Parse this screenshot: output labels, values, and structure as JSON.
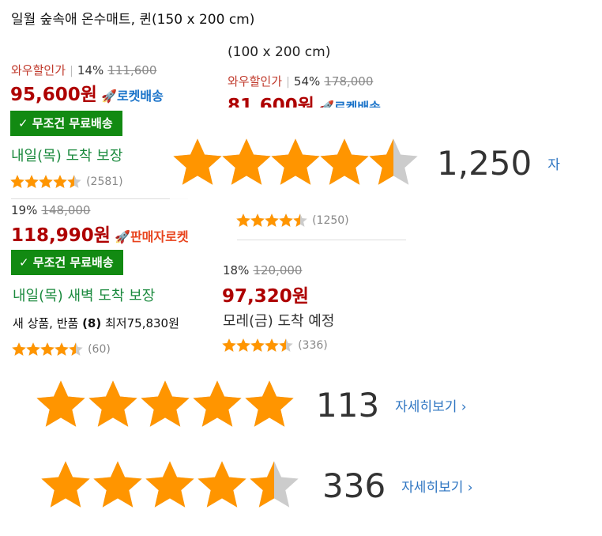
{
  "product1": {
    "title": "일월 숲속애 온수매트, 퀸(150 x 200 cm)",
    "wow_label": "와우할인가",
    "discount": "14%",
    "original_price": "111,600",
    "price": "95,600원",
    "rocket_label": "로켓배송",
    "free_shipping": "무조건 무료배송",
    "delivery": "내일(목) 도착 보장",
    "rating": 4.5,
    "review_count": "(2581)"
  },
  "product2": {
    "title": "(100 x 200 cm)",
    "wow_label": "와우할인가",
    "discount": "54%",
    "original_price": "178,000",
    "price": "81,600원",
    "rocket_label": "로켓배송",
    "rating": 4.5,
    "review_count": "(1250)"
  },
  "product3": {
    "discount": "19%",
    "original_price": "148,000",
    "price": "118,990원",
    "seller_rocket_label": "판매자로켓",
    "free_shipping": "무조건 무료배송",
    "delivery": "내일(목) 새벽 도착 보장",
    "used_info_prefix": "새 상품, 반품 ",
    "used_info_count": "(8)",
    "used_info_lowest": " 최저75,830원",
    "rating": 4.5,
    "review_count": "(60)"
  },
  "product4": {
    "discount": "18%",
    "original_price": "120,000",
    "price": "97,320원",
    "delivery": "모레(금) 도착 예정",
    "rating": 4.5,
    "review_count": "(336)"
  },
  "popup_1250": {
    "rating": 4.5,
    "count": "1,250",
    "more": "자"
  },
  "popup_113": {
    "rating": 5,
    "count": "113",
    "more": "자세히보기 ›"
  },
  "popup_336": {
    "rating": 4.5,
    "count": "336",
    "more": "자세히보기 ›"
  },
  "colors": {
    "star": "#ff9500",
    "star_empty": "#cccccc",
    "price": "#ae0000",
    "rocket": "#1a73c9",
    "green_badge": "#128a12"
  }
}
